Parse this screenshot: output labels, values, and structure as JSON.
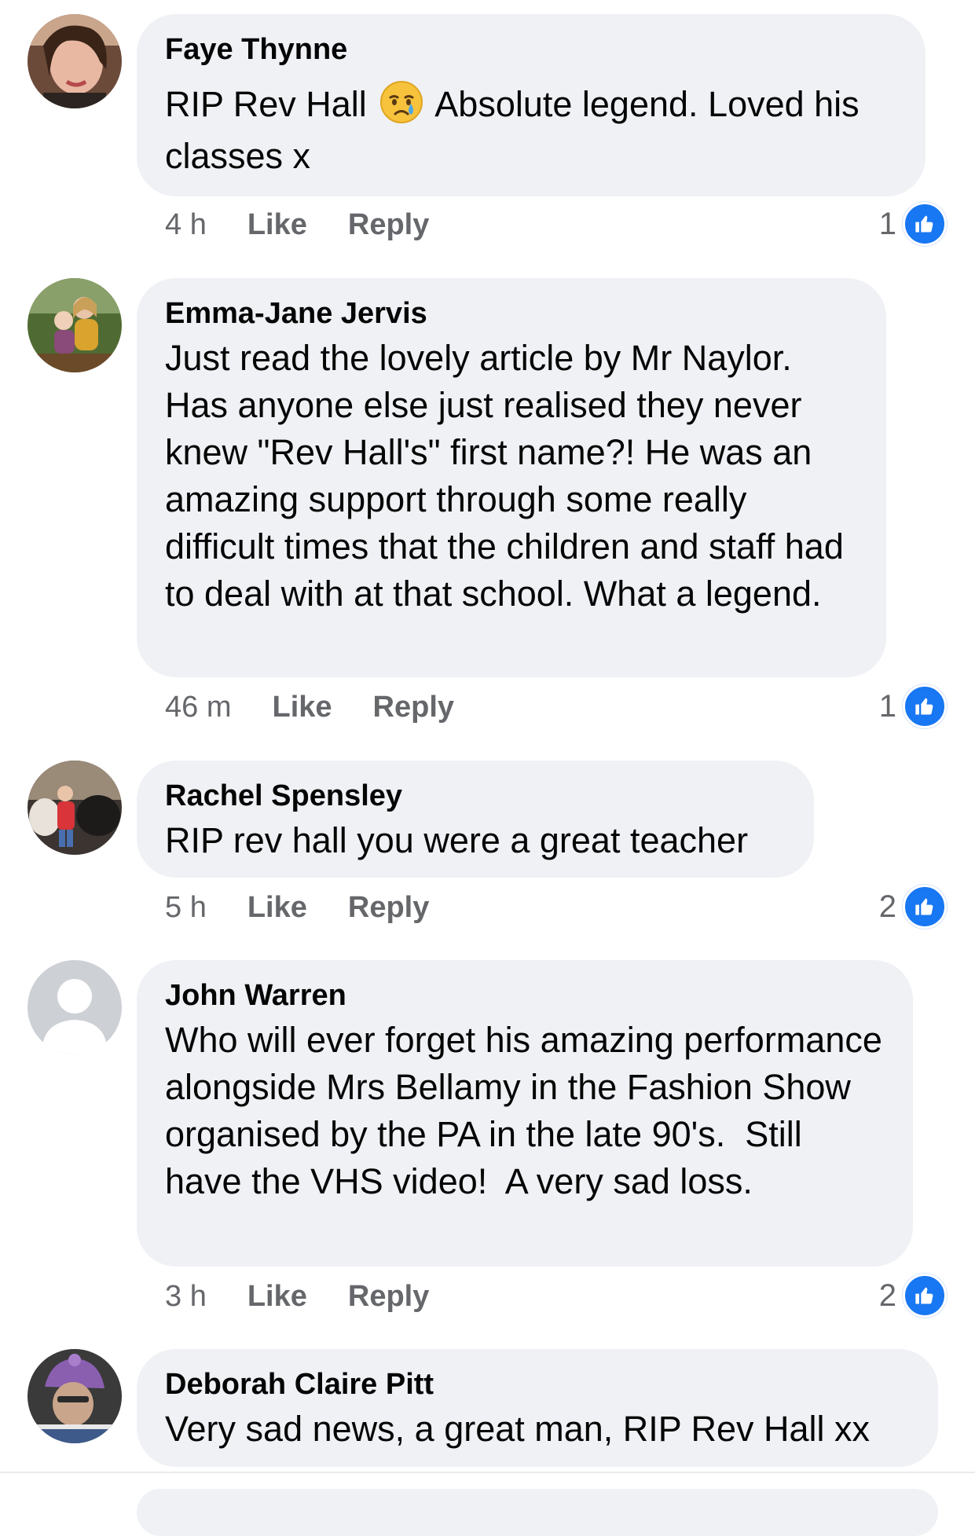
{
  "comments": [
    {
      "author": "Faye Thynne",
      "text_before_emoji": "RIP Rev Hall ",
      "emoji": "crying-face",
      "text_after_emoji": " Absolute legend. Loved his classes x",
      "time": "4 h",
      "like_label": "Like",
      "reply_label": "Reply",
      "reaction_count": "1"
    },
    {
      "author": "Emma-Jane Jervis",
      "text": "Just read the lovely article by Mr Naylor. Has anyone else just realised they never knew \"Rev Hall's\" first name?! He was an amazing support through some really difficult times that the children and staff had to deal with at that school. What a legend.",
      "time": "46 m",
      "like_label": "Like",
      "reply_label": "Reply",
      "reaction_count": "1"
    },
    {
      "author": "Rachel Spensley",
      "text": "RIP rev hall you were a great teacher",
      "time": "5 h",
      "like_label": "Like",
      "reply_label": "Reply",
      "reaction_count": "2"
    },
    {
      "author": "John Warren",
      "text": "Who will ever forget his amazing performance alongside Mrs Bellamy in the Fashion Show organised by the PA in the late 90's.  Still have the VHS video!  A very sad loss.",
      "time": "3 h",
      "like_label": "Like",
      "reply_label": "Reply",
      "reaction_count": "2"
    },
    {
      "author": "Deborah Claire Pitt",
      "text": "Very sad news, a great man, RIP Rev Hall xx"
    }
  ],
  "colors": {
    "bubble": "#eff1f5",
    "meta": "#65676b",
    "like_blue": "#1877f2"
  }
}
